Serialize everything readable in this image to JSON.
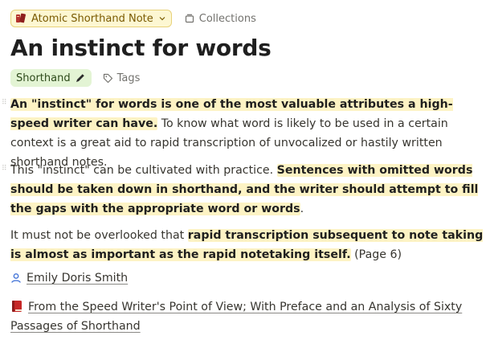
{
  "header": {
    "type_label": "Atomic Shorthand Note",
    "collections_label": "Collections"
  },
  "page": {
    "title": "An instinct for words"
  },
  "tags": {
    "tag_label": "Shorthand",
    "tags_button_label": "Tags"
  },
  "paragraphs": [
    {
      "segments": [
        {
          "text": "An \"instinct\" for words is one of the most valuable attributes a high-speed writer can have.",
          "highlight": true
        },
        {
          "text": " To know what word is likely to be used in a certain context is a great aid to rapid transcription of unvocalized or hastily written shorthand notes.",
          "highlight": false
        }
      ]
    },
    {
      "segments": [
        {
          "text": "This \"instinct\" can be cultivated with practice. ",
          "highlight": false
        },
        {
          "text": "Sentences with omitted words should be taken down in shorthand, and the writer should attempt to fill the gaps with the appropriate word or words",
          "highlight": true
        },
        {
          "text": ".",
          "highlight": false
        }
      ]
    },
    {
      "segments": [
        {
          "text": "It must not be overlooked that ",
          "highlight": false
        },
        {
          "text": "rapid transcription subsequent to note taking is almost as important as the rapid notetaking itself.",
          "highlight": true
        },
        {
          "text": " (Page 6)",
          "highlight": false
        }
      ]
    }
  ],
  "author": {
    "name": "Emily Doris Smith",
    "icon": "person-icon"
  },
  "source": {
    "title": "From the Speed Writer's Point of View; With Preface and an Analysis of Sixty Passages of Shorthand",
    "icon": "red-book-icon"
  },
  "colors": {
    "highlight": "#fdf3c4",
    "type_chip_bg": "#fdf7d2",
    "type_chip_border": "#e8d27a",
    "tag_chip_bg": "#e3f4d4",
    "author_icon": "#3b6ed6",
    "book_red": "#c62828"
  }
}
